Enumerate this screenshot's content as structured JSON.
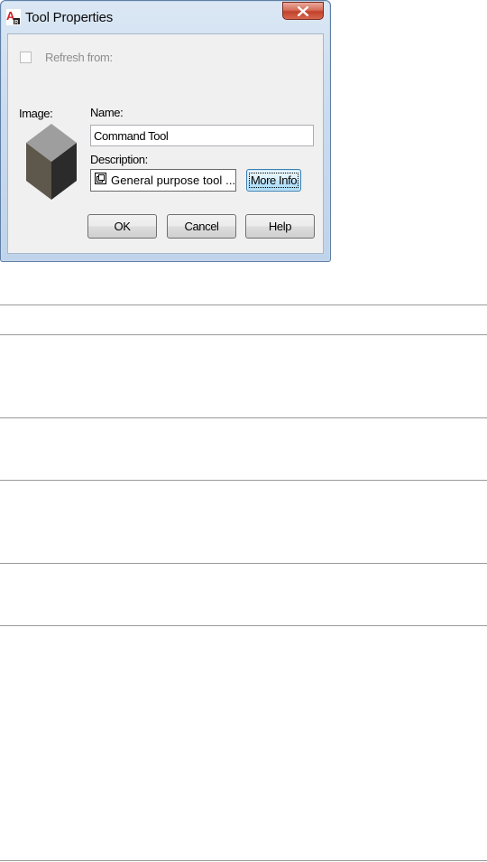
{
  "dialog": {
    "title": "Tool Properties",
    "refresh_label": "Refresh from:",
    "refresh_checked": false,
    "image_label": "Image:",
    "name_label": "Name:",
    "name_value": "Command Tool",
    "description_label": "Description:",
    "description_value": "General purpose tool ...",
    "buttons": {
      "more_info": "More Info",
      "ok": "OK",
      "cancel": "Cancel",
      "help": "Help"
    },
    "icons": {
      "app": "autocad-app-icon",
      "close": "close-icon",
      "image_preview": "cube-icon",
      "description": "copy-icon"
    },
    "colors": {
      "close_button": "#c2412a",
      "focused_button_border": "#3c7fb1",
      "window_frame": "#c9dbef",
      "disabled_text": "#8d8d8d"
    }
  }
}
